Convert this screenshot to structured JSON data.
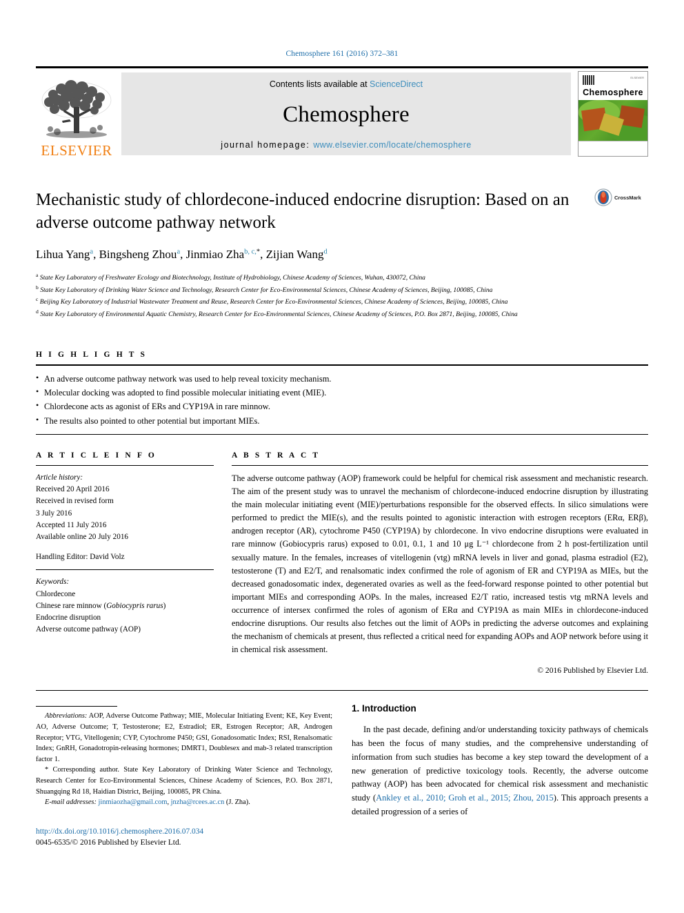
{
  "running_head": "Chemosphere 161 (2016) 372–381",
  "masthead": {
    "contents_prefix": "Contents lists available at ",
    "sciencedirect": "ScienceDirect",
    "journal_title": "Chemosphere",
    "homepage_label": "journal homepage: ",
    "homepage_url": "www.elsevier.com/locate/chemosphere",
    "publisher_logo_text": "ELSEVIER",
    "cover_journal_name": "Chemosphere",
    "cover_publisher": "ELSEVIER"
  },
  "article": {
    "title": "Mechanistic study of chlordecone-induced endocrine disruption: Based on an adverse outcome pathway network",
    "crossmark_label": "CrossMark",
    "authors": [
      {
        "name": "Lihua Yang",
        "marks": "a"
      },
      {
        "name": "Bingsheng Zhou",
        "marks": "a"
      },
      {
        "name": "Jinmiao Zha",
        "marks": "b, c,",
        "corresponding": "*"
      },
      {
        "name": "Zijian Wang",
        "marks": "d"
      }
    ],
    "affiliations": [
      {
        "mark": "a",
        "text": "State Key Laboratory of Freshwater Ecology and Biotechnology, Institute of Hydrobiology, Chinese Academy of Sciences, Wuhan, 430072, China"
      },
      {
        "mark": "b",
        "text": "State Key Laboratory of Drinking Water Science and Technology, Research Center for Eco-Environmental Sciences, Chinese Academy of Sciences, Beijing, 100085, China"
      },
      {
        "mark": "c",
        "text": "Beijing Key Laboratory of Industrial Wastewater Treatment and Reuse, Research Center for Eco-Environmental Sciences, Chinese Academy of Sciences, Beijing, 100085, China"
      },
      {
        "mark": "d",
        "text": "State Key Laboratory of Environmental Aquatic Chemistry, Research Center for Eco-Environmental Sciences, Chinese Academy of Sciences, P.O. Box 2871, Beijing, 100085, China"
      }
    ]
  },
  "highlights": {
    "heading": "H I G H L I G H T S",
    "items": [
      "An adverse outcome pathway network was used to help reveal toxicity mechanism.",
      "Molecular docking was adopted to find possible molecular initiating event (MIE).",
      "Chlordecone acts as agonist of ERs and CYP19A in rare minnow.",
      "The results also pointed to other potential but important MIEs."
    ]
  },
  "article_info": {
    "heading": "A R T I C L E   I N F O",
    "history_label": "Article history:",
    "history": [
      "Received 20 April 2016",
      "Received in revised form",
      "3 July 2016",
      "Accepted 11 July 2016",
      "Available online 20 July 2016"
    ],
    "handling_editor": "Handling Editor: David Volz",
    "keywords_label": "Keywords:",
    "keywords": [
      "Chlordecone",
      "Chinese rare minnow (Gobiocypris rarus)",
      "Endocrine disruption",
      "Adverse outcome pathway (AOP)"
    ],
    "keyword_species_italic": "Gobiocypris rarus"
  },
  "abstract": {
    "heading": "A B S T R A C T",
    "text": "The adverse outcome pathway (AOP) framework could be helpful for chemical risk assessment and mechanistic research. The aim of the present study was to unravel the mechanism of chlordecone-induced endocrine disruption by illustrating the main molecular initiating event (MIE)/perturbations responsible for the observed effects. In silico simulations were performed to predict the MIE(s), and the results pointed to agonistic interaction with estrogen receptors (ERα, ERβ), androgen receptor (AR), cytochrome P450 (CYP19A) by chlordecone. In vivo endocrine disruptions were evaluated in rare minnow (Gobiocypris rarus) exposed to 0.01, 0.1, 1 and 10 μg L⁻¹ chlordecone from 2 h post-fertilization until sexually mature. In the females, increases of vitellogenin (vtg) mRNA levels in liver and gonad, plasma estradiol (E2), testosterone (T) and E2/T, and renalsomatic index confirmed the role of agonism of ER and CYP19A as MIEs, but the decreased gonadosomatic index, degenerated ovaries as well as the feed-forward response pointed to other potential but important MIEs and corresponding AOPs. In the males, increased E2/T ratio, increased testis vtg mRNA levels and occurrence of intersex confirmed the roles of agonism of ERα and CYP19A as main MIEs in chlordecone-induced endocrine disruptions. Our results also fetches out the limit of AOPs in predicting the adverse outcomes and explaining the mechanism of chemicals at present, thus reflected a critical need for expanding AOPs and AOP network before using it in chemical risk assessment.",
    "copyright": "© 2016 Published by Elsevier Ltd."
  },
  "footnotes": {
    "abbreviations_label": "Abbreviations:",
    "abbreviations_text": " AOP, Adverse Outcome Pathway; MIE, Molecular Initiating Event; KE, Key Event; AO, Adverse Outcome; T, Testosterone; E2, Estradiol; ER, Estrogen Receptor; AR, Androgen Receptor; VTG, Vitellogenin; CYP, Cytochrome P450; GSI, Gonadosomatic Index; RSI, Renalsomatic Index; GnRH, Gonadotropin-releasing hormones; DMRT1, Doublesex and mab-3 related transcription factor 1.",
    "corresponding_marker": "*",
    "corresponding_text": " Corresponding author. State Key Laboratory of Drinking Water Science and Technology, Research Center for Eco-Environmental Sciences, Chinese Academy of Sciences, P.O. Box 2871, Shuangqing Rd 18, Haidian District, Beijing, 100085, PR China.",
    "email_label": "E-mail addresses:",
    "emails": [
      "jinmiaozha@gmail.com",
      "jnzha@rcees.ac.cn"
    ],
    "email_attrib": "(J. Zha)."
  },
  "doi_block": {
    "doi_url": "http://dx.doi.org/10.1016/j.chemosphere.2016.07.034",
    "issn_line": "0045-6535/© 2016 Published by Elsevier Ltd."
  },
  "introduction": {
    "heading": "1. Introduction",
    "paragraph_part1": "In the past decade, defining and/or understanding toxicity pathways of chemicals has been the focus of many studies, and the comprehensive understanding of information from such studies has become a key step toward the development of a new generation of predictive toxicology tools. Recently, the adverse outcome pathway (AOP) has been advocated for chemical risk assessment and mechanistic study (",
    "citation": "Ankley et al., 2010; Groh et al., 2015; Zhou, 2015",
    "paragraph_part2": "). This approach presents a detailed progression of a series of"
  },
  "colors": {
    "link_blue": "#1b6ca8",
    "sciencedirect_blue": "#3c8dbc",
    "elsevier_orange": "#f07f13",
    "affiliation_mark": "#2e86ab"
  }
}
